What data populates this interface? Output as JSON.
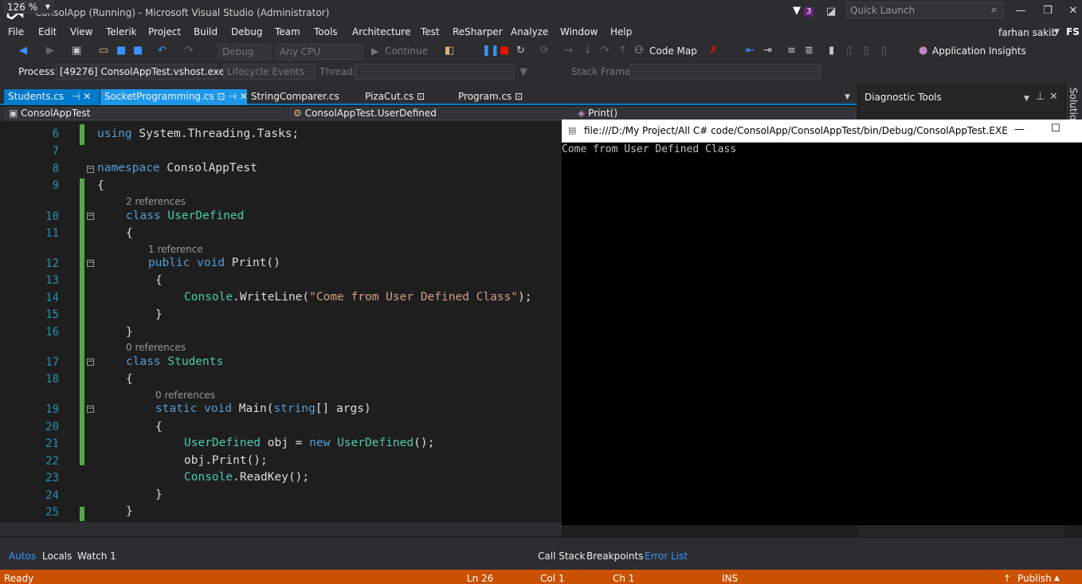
{
  "window": {
    "title": "ConsolApp (Running) - Microsoft Visual Studio (Administrator)",
    "notification_count": "3",
    "quick_launch_placeholder": "Quick Launch",
    "user_name": "farhan sakib",
    "user_initials": "FS"
  },
  "menu": [
    "File",
    "Edit",
    "View",
    "Telerik",
    "Project",
    "Build",
    "Debug",
    "Team",
    "Tools",
    "Architecture",
    "Test",
    "ReSharper",
    "Analyze",
    "Window",
    "Help"
  ],
  "toolbar": {
    "config": "Debug",
    "platform": "Any CPU",
    "continue": "Continue",
    "code_map": "Code Map",
    "app_insights": "Application Insights",
    "process_label": "Process:",
    "process_value": "[49276] ConsolAppTest.vshost.exe",
    "lifecycle": "Lifecycle Events",
    "thread_label": "Thread:",
    "stack_frame_label": "Stack Frame:"
  },
  "tabs": [
    {
      "label": "Students.cs",
      "state": "active"
    },
    {
      "label": "SocketProgramming.cs",
      "state": "selected"
    },
    {
      "label": "StringComparer.cs",
      "state": "normal"
    },
    {
      "label": "PizaCut.cs",
      "state": "normal"
    },
    {
      "label": "Program.cs",
      "state": "normal"
    }
  ],
  "navbar": {
    "project": "ConsolAppTest",
    "class": "ConsolAppTest.UserDefined",
    "member": "Print()"
  },
  "editor": {
    "line6_text": "using System.Threading.Tasks;",
    "refs_2": "2 references",
    "refs_1": "1 reference",
    "refs_0a": "0 references",
    "refs_0b": "0 references"
  },
  "zoom": "126 %",
  "diagnostic": {
    "title": "Diagnostic Tools",
    "solution_tab": "Solutio"
  },
  "console": {
    "title": "file:///D:/My Project/All C# code/ConsolApp/ConsolAppTest/bin/Debug/ConsolAppTest.EXE",
    "output": "Come from User Defined Class"
  },
  "bottom_tabs_left": [
    "Autos",
    "Locals",
    "Watch 1"
  ],
  "bottom_tabs_right": [
    "Call Stack",
    "Breakpoints",
    "Error List"
  ],
  "status": {
    "ready": "Ready",
    "ln": "Ln 26",
    "col": "Col 1",
    "ch": "Ch 1",
    "ins": "INS",
    "publish": "Publish"
  },
  "colors": {
    "accent": "#007acc",
    "status_bar": "#ca5100",
    "keyword": "#569cd6",
    "type": "#4ec9b0",
    "string": "#d69d85"
  }
}
